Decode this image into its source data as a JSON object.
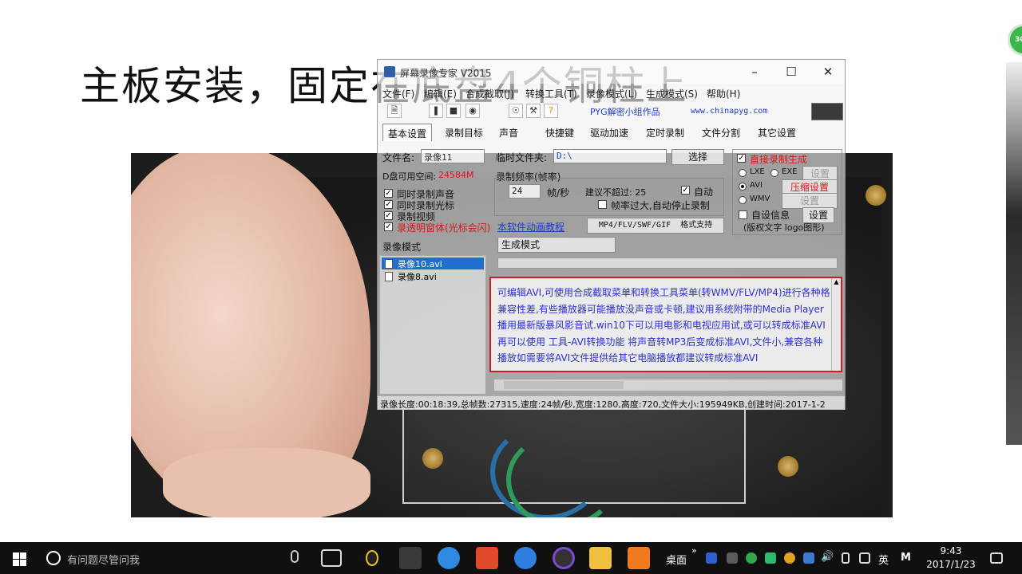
{
  "slide": {
    "title": "主板安装，固定在底盘4个铜柱上"
  },
  "app": {
    "title": "屏幕录像专家 V2015",
    "menu": [
      "文件(F)",
      "编辑(E)",
      "合成截取(J)",
      "转换工具(T)",
      "录像模式(L)",
      "生成模式(S)",
      "帮助(H)"
    ],
    "toolbar_link": "PYG解密小组作品",
    "toolbar_url": "www.chinapyg.com",
    "tabs": [
      "基本设置",
      "录制目标",
      "声音",
      "快捷键",
      "驱动加速",
      "定时录制",
      "文件分割",
      "其它设置"
    ],
    "filename_label": "文件名:",
    "filename_value": "录像11",
    "temp_folder_label": "临时文件夹:",
    "temp_folder_value": "D:\\",
    "choose_button": "选择",
    "disk_space_label": "D盘可用空间:",
    "disk_space_value": "24584M",
    "framerate_group": "录制频率(帧率)",
    "framerate_value": "24",
    "framerate_unit": "帧/秒",
    "suggest_label": "建议不超过: 25",
    "auto_label": "自动",
    "auto_stop_label": "帧率过大,自动停止录制",
    "options": [
      "同时录制声音",
      "同时录制光标",
      "录制视频"
    ],
    "transparent_option": "录透明窗体(光标会闪)",
    "tutorial_link": "本软件动画教程",
    "format_label": "MP4/FLV/SWF/GIF",
    "format_support_button": "格式支持",
    "direct_generate": "直接录制生成",
    "lxe": "LXE",
    "exe": "EXE",
    "settings": "设置",
    "avi": "AVI",
    "compress_settings": "压缩设置",
    "wmv": "WMV",
    "custom_info": "自设信息",
    "custom_info_settings": "设置",
    "copyright_text": "(版权文字 logo图形)",
    "record_mode_label": "录像模式",
    "generate_mode_label": "生成模式",
    "files": [
      "录像10.avi",
      "录像8.avi"
    ],
    "info_text": "可编辑AVI,可使用合成截取菜单和转换工具菜单(转WMV/FLV/MP4)进行各种格兼容性差,有些播放器可能播放没声音或卡顿,建议用系统附带的Media Player播用最新版暴风影音试.win10下可以用电影和电视应用试,或可以转成标准AVI再可以使用 工具-AVI转换功能 将声音转MP3后变成标准AVI,文件小,兼容各种播放如需要将AVI文件提供给其它电脑播放都建议转成标准AVI",
    "status": "录像长度:00:18:39,总帧数:27315,速度:24帧/秒,宽度:1280,高度:720,文件大小:195949KB,创建时间:2017-1-2"
  },
  "taskbar": {
    "search_placeholder": "有问题尽管问我",
    "desktop_label": "桌面",
    "ime_label": "英",
    "m_label": "M",
    "time": "9:43",
    "date": "2017/1/23"
  },
  "badge": "30"
}
